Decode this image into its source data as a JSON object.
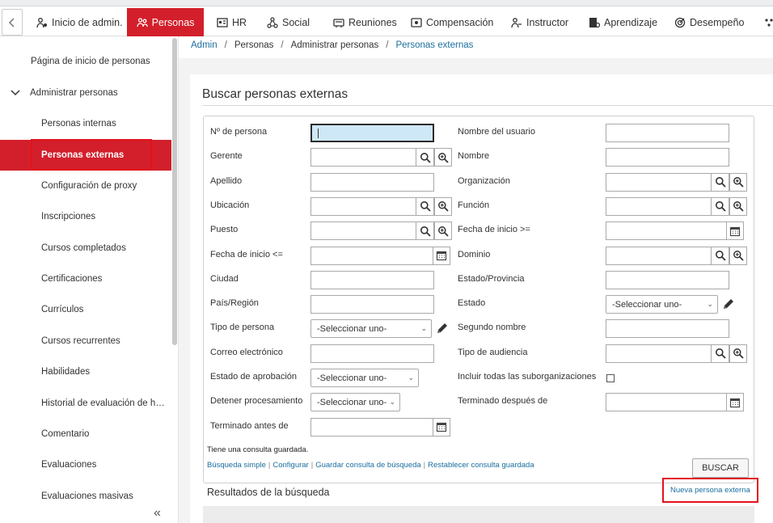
{
  "nav": {
    "tabs": [
      {
        "label": "Inicio de admin.",
        "icon": "admin-home-icon",
        "active": false
      },
      {
        "label": "Personas",
        "icon": "people-icon",
        "active": true
      },
      {
        "label": "HR",
        "icon": "hr-icon",
        "active": false
      },
      {
        "label": "Social",
        "icon": "social-icon",
        "active": false
      },
      {
        "label": "Reuniones",
        "icon": "meetings-icon",
        "active": false
      },
      {
        "label": "Compensación",
        "icon": "compensation-icon",
        "active": false
      },
      {
        "label": "Instructor",
        "icon": "instructor-icon",
        "active": false
      },
      {
        "label": "Aprendizaje",
        "icon": "learning-icon",
        "active": false
      },
      {
        "label": "Desempeño",
        "icon": "performance-icon",
        "active": false
      }
    ],
    "accent": "#d31f2b"
  },
  "sidebar": {
    "home": "Página de inicio de personas",
    "section": "Administrar personas",
    "items": [
      "Personas internas",
      "Personas externas",
      "Configuración de proxy",
      "Inscripciones",
      "Cursos completados",
      "Certificaciones",
      "Currículos",
      "Cursos recurrentes",
      "Habilidades",
      "Historial de evaluación de habilidades",
      "Comentario",
      "Evaluaciones",
      "Evaluaciones masivas"
    ],
    "active_index": 1,
    "collapse_icon": "double-chevron-left-icon"
  },
  "breadcrumb": {
    "items": [
      "Admin",
      "Personas",
      "Administrar personas",
      "Personas externas"
    ],
    "sep": "/"
  },
  "search": {
    "title": "Buscar personas externas",
    "left": [
      {
        "label": "Nº de persona",
        "type": "text",
        "value": ""
      },
      {
        "label": "Gerente",
        "type": "lookup",
        "value": ""
      },
      {
        "label": "Apellido",
        "type": "text",
        "value": ""
      },
      {
        "label": "Ubicación",
        "type": "lookup",
        "value": ""
      },
      {
        "label": "Puesto",
        "type": "lookup",
        "value": ""
      },
      {
        "label": "Fecha de inicio <=",
        "type": "date",
        "value": ""
      },
      {
        "label": "Ciudad",
        "type": "text",
        "value": ""
      },
      {
        "label": "País/Región",
        "type": "text",
        "value": ""
      },
      {
        "label": "Tipo de persona",
        "type": "select",
        "value": "-Seleccionar uno-"
      },
      {
        "label": "Correo electrónico",
        "type": "text",
        "value": ""
      },
      {
        "label": "Estado de aprobación",
        "type": "select",
        "value": "-Seleccionar uno-"
      },
      {
        "label": "Detener procesamiento",
        "type": "select",
        "value": "-Seleccionar uno-"
      },
      {
        "label": "Terminado antes de",
        "type": "date",
        "value": ""
      }
    ],
    "right": [
      {
        "label": "Nombre del usuario",
        "type": "text",
        "value": ""
      },
      {
        "label": "Nombre",
        "type": "text",
        "value": ""
      },
      {
        "label": "Organización",
        "type": "lookup",
        "value": ""
      },
      {
        "label": "Función",
        "type": "lookup",
        "value": ""
      },
      {
        "label": "Fecha de inicio >=",
        "type": "date",
        "value": ""
      },
      {
        "label": "Dominio",
        "type": "lookup",
        "value": ""
      },
      {
        "label": "Estado/Provincia",
        "type": "text",
        "value": ""
      },
      {
        "label": "Estado",
        "type": "select",
        "value": "-Seleccionar uno-"
      },
      {
        "label": "Segundo nombre",
        "type": "text",
        "value": ""
      },
      {
        "label": "Tipo de audiencia",
        "type": "lookup",
        "value": ""
      },
      {
        "label": "Incluir todas las suborganizaciones",
        "type": "checkbox",
        "checked": false
      },
      {
        "label": "Terminado después de",
        "type": "date",
        "value": ""
      }
    ],
    "saved_query_note": "Tiene una consulta guardada.",
    "links": [
      "Búsqueda simple",
      "Configurar",
      "Guardar consulta de búsqueda",
      "Restablecer consulta guardada"
    ],
    "submit_label": "BUSCAR"
  },
  "results": {
    "title": "Resultados de la búsqueda",
    "new_link": "Nueva persona externa"
  },
  "highlight_color": "#e3121c"
}
